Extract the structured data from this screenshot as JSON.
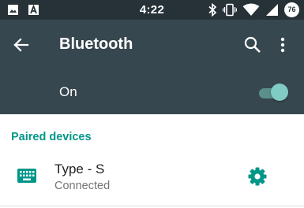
{
  "status_bar": {
    "time": "4:22",
    "battery_level": "76",
    "icons": [
      "image-icon",
      "a-icon",
      "bluetooth-icon",
      "vibrate-icon",
      "wifi-icon",
      "signal-icon",
      "battery-icon"
    ]
  },
  "toolbar": {
    "title": "Bluetooth",
    "icons": [
      "back-arrow-icon",
      "search-icon",
      "more-vert-icon"
    ]
  },
  "bluetooth_switch": {
    "label": "On",
    "enabled": true
  },
  "paired_devices": {
    "header": "Paired devices",
    "devices": [
      {
        "name": "Type - S",
        "status": "Connected",
        "icon": "keyboard-icon",
        "action_icon": "settings-gear-icon"
      }
    ]
  },
  "colors": {
    "status_bar_bg": "#263238",
    "toolbar_bg": "#37474f",
    "accent": "#009688",
    "toggle_thumb": "#80cbc4"
  }
}
